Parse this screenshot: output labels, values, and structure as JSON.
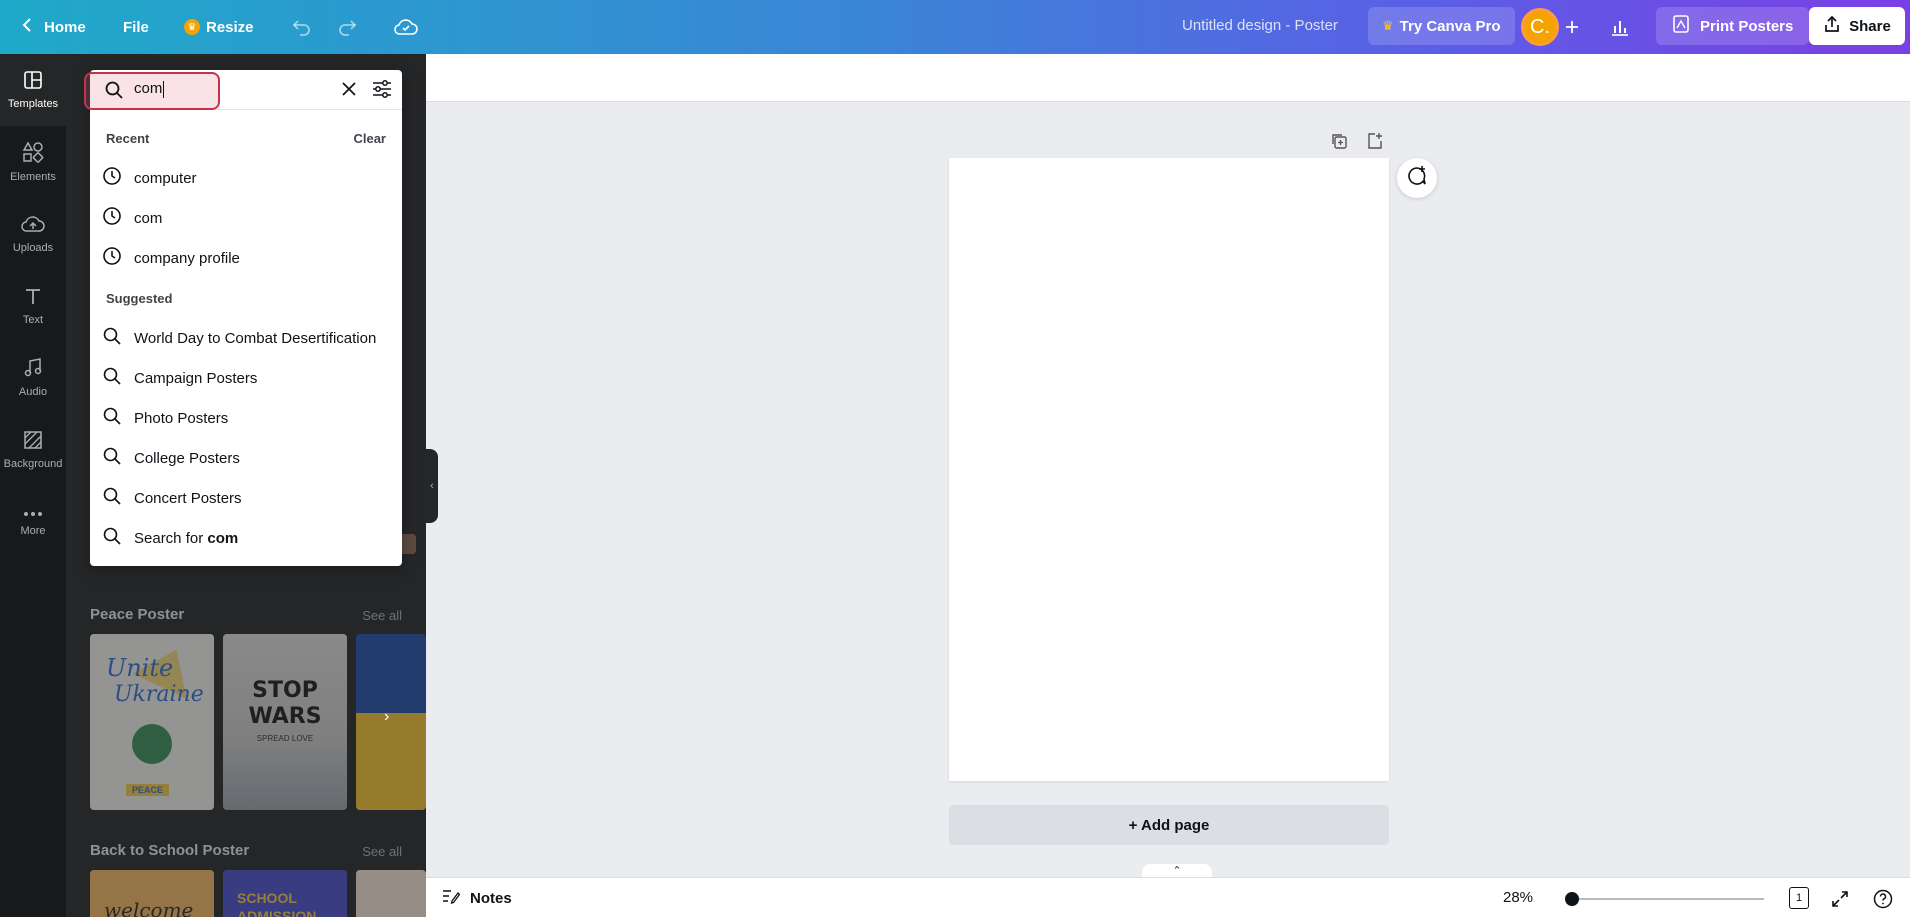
{
  "topbar": {
    "home_label": "Home",
    "file_label": "File",
    "resize_label": "Resize",
    "design_title": "Untitled design - Poster",
    "pro_label": "Try Canva Pro",
    "avatar_letter": "C.",
    "print_label": "Print Posters",
    "share_label": "Share"
  },
  "rail": {
    "items": [
      {
        "label": "Templates"
      },
      {
        "label": "Elements"
      },
      {
        "label": "Uploads"
      },
      {
        "label": "Text"
      },
      {
        "label": "Audio"
      },
      {
        "label": "Background"
      },
      {
        "label": "More"
      }
    ]
  },
  "search": {
    "value": "com",
    "recent_heading": "Recent",
    "clear_label": "Clear",
    "recent": [
      "computer",
      "com",
      "company profile"
    ],
    "suggested_heading": "Suggested",
    "suggested": [
      "World Day to Combat Desertification",
      "Campaign Posters",
      "Photo Posters",
      "College Posters",
      "Concert Posters"
    ],
    "search_for_prefix": "Search for ",
    "search_for_term": "com"
  },
  "panel": {
    "sections": [
      {
        "title": "Peace Poster",
        "see_all": "See all",
        "thumbs": [
          {
            "text1": "Unite",
            "text2": "Ukraine",
            "badge": "PEACE"
          },
          {
            "text1": "STOP",
            "text2": "WARS",
            "text3": "SPREAD LOVE"
          }
        ]
      },
      {
        "title": "Back to School Poster",
        "see_all": "See all",
        "thumbs": [
          {
            "text1": "welcome"
          },
          {
            "text1": "SCHOOL",
            "text2": "ADMISSION"
          }
        ]
      }
    ]
  },
  "canvas": {
    "add_page_label": "+ Add page"
  },
  "bottombar": {
    "notes_label": "Notes",
    "zoom": "28%",
    "zoom_percent": 28,
    "page_count": "1"
  },
  "colors": {
    "accent": "#7d2ae8",
    "avatar": "#f4a300",
    "highlight": "#c8314a"
  }
}
